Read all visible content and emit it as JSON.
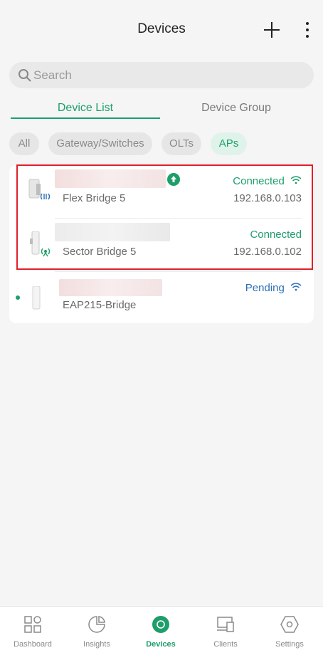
{
  "header": {
    "title": "Devices"
  },
  "search": {
    "placeholder": "Search"
  },
  "tabs": [
    {
      "label": "Device List",
      "active": true
    },
    {
      "label": "Device Group",
      "active": false
    }
  ],
  "filters": [
    {
      "label": "All",
      "active": false
    },
    {
      "label": "Gateway/Switches",
      "active": false
    },
    {
      "label": "OLTs",
      "active": false
    },
    {
      "label": "APs",
      "active": true
    }
  ],
  "devices": [
    {
      "model": "Flex Bridge 5",
      "status": "Connected",
      "ip": "192.168.0.103",
      "status_color": "#1e9e6a",
      "has_update": true,
      "has_wifi": true
    },
    {
      "model": "Sector Bridge 5",
      "status": "Connected",
      "ip": "192.168.0.102",
      "status_color": "#1e9e6a",
      "has_update": false,
      "has_wifi": false
    },
    {
      "model": "EAP215-Bridge",
      "status": "Pending",
      "ip": "",
      "status_color": "#2a6fb5",
      "has_update": false,
      "has_wifi": true
    }
  ],
  "nav": [
    {
      "label": "Dashboard",
      "icon": "dashboard-icon",
      "active": false
    },
    {
      "label": "Insights",
      "icon": "insights-icon",
      "active": false
    },
    {
      "label": "Devices",
      "icon": "devices-icon",
      "active": true
    },
    {
      "label": "Clients",
      "icon": "clients-icon",
      "active": false
    },
    {
      "label": "Settings",
      "icon": "settings-icon",
      "active": false
    }
  ],
  "colors": {
    "accent": "#1e9e6a",
    "pending": "#2a6fb5",
    "highlight": "#e0202a"
  }
}
